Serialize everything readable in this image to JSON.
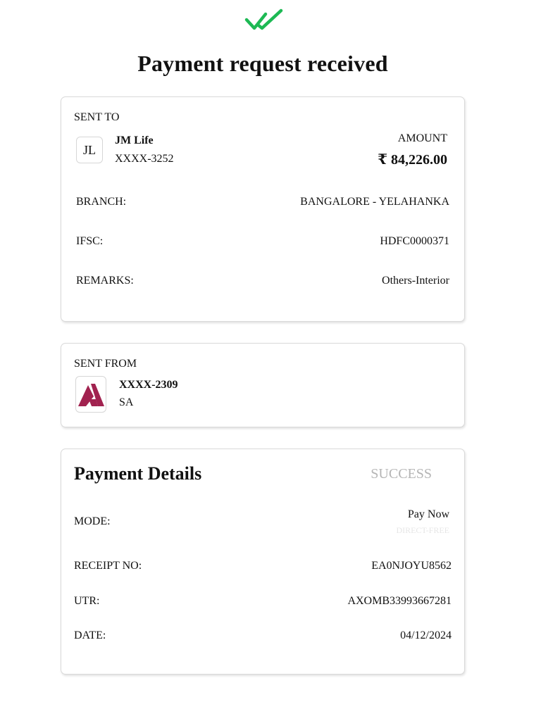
{
  "header": {
    "icon": "double-check-icon",
    "icon_color": "#1db954",
    "title": "Payment request received"
  },
  "sent_to": {
    "section_label": "SENT TO",
    "avatar_initials": "JL",
    "name": "JM Life",
    "account": "XXXX-3252",
    "amount_label": "AMOUNT",
    "amount": "₹ 84,226.00",
    "rows": [
      {
        "label": "BRANCH:",
        "value": "BANGALORE - YELAHANKA"
      },
      {
        "label": "IFSC:",
        "value": "HDFC0000371"
      },
      {
        "label": "REMARKS:",
        "value": "Others-Interior"
      }
    ]
  },
  "sent_from": {
    "section_label": "SENT FROM",
    "bank_logo": "axis-bank-logo-icon",
    "brand_color": "#a1224f",
    "account": "XXXX-2309",
    "name": "SA"
  },
  "payment_details": {
    "heading": "Payment Details",
    "status": "SUCCESS",
    "status_color": "#b5b5b5",
    "mode_label": "MODE:",
    "mode_value": "Pay Now",
    "mode_sub": "DIRECT-FREE",
    "rows": [
      {
        "label": "RECEIPT NO:",
        "value": "EA0NJOYU8562"
      },
      {
        "label": "UTR:",
        "value": "AXOMB33993667281"
      },
      {
        "label": "DATE:",
        "value": "04/12/2024"
      }
    ]
  }
}
